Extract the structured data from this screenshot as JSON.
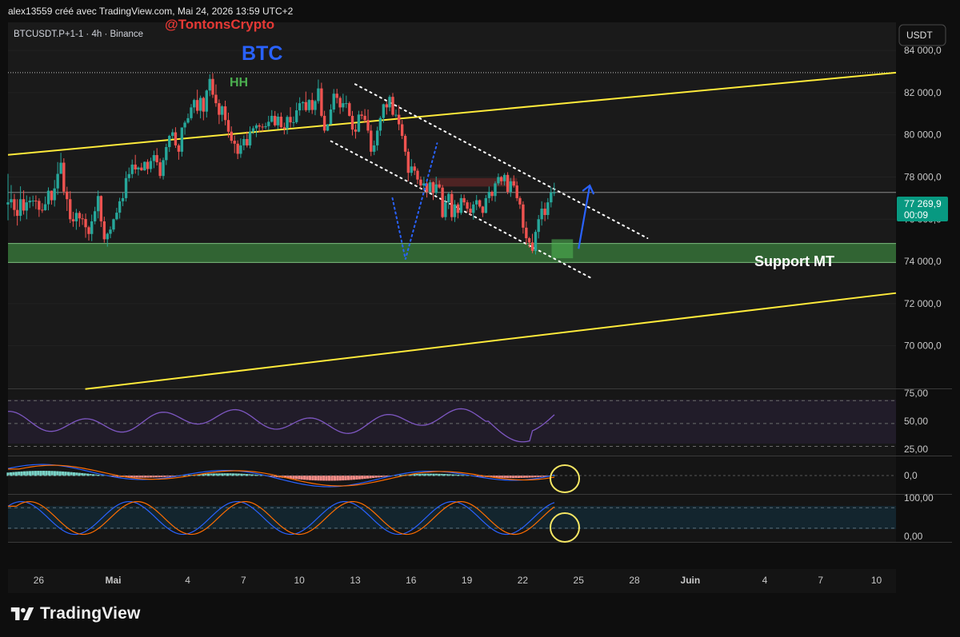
{
  "header": {
    "credit": "alex13559 créé avec TradingView.com, Mai 24, 2026 13:59 UTC+2"
  },
  "chart_data": {
    "type": "candlestick",
    "symbol_line": "BTCUSDT.P+1-1 · 4h · Binance",
    "currency_button": "USDT",
    "watermark": "@TontonsCrypto",
    "title": "BTC",
    "annotations": {
      "hh": "HH",
      "support": "Support MT"
    },
    "last_price": {
      "value": 77269.9,
      "label": "77 269,9",
      "countdown": "00:09"
    },
    "price_axis": {
      "ticks": [
        84000,
        82000,
        80000,
        78000,
        76000,
        74000,
        72000,
        70000
      ],
      "labels": [
        "84 000,0",
        "82 000,0",
        "80 000,0",
        "78 000,0",
        "76 000,0",
        "74 000,0",
        "72 000,0",
        "70 000,0"
      ],
      "range": [
        67980,
        85330
      ]
    },
    "time_axis": {
      "labels": [
        "26",
        "Mai",
        "4",
        "7",
        "10",
        "13",
        "16",
        "19",
        "22",
        "25",
        "28",
        "Juin",
        "4",
        "7",
        "10"
      ],
      "day_index": [
        26,
        30,
        34,
        37,
        40,
        43,
        46,
        49,
        52,
        55,
        58,
        61,
        65,
        68,
        71
      ],
      "range": [
        24.35,
        72.05
      ]
    },
    "high_line": 82950,
    "support_zone": [
      73950,
      74850
    ],
    "channel": {
      "upper": [
        [
          24.35,
          79050
        ],
        [
          72.05,
          82950
        ]
      ],
      "lower": [
        [
          28.5,
          67950
        ],
        [
          72.05,
          72500
        ]
      ]
    },
    "descending_channel": {
      "upper": [
        [
          43.0,
          82400
        ],
        [
          58.7,
          75100
        ]
      ],
      "lower": [
        [
          41.7,
          79700
        ],
        [
          55.7,
          73200
        ]
      ]
    },
    "projection": {
      "past": [
        [
          45.0,
          77000
        ],
        [
          45.7,
          74100
        ],
        [
          47.4,
          79600
        ]
      ],
      "future": [
        [
          55.0,
          74600
        ],
        [
          55.6,
          77600
        ]
      ]
    },
    "candles": [
      [
        24.35,
        76700,
        76800,
        78150,
        75950
      ],
      [
        24.52,
        76800,
        76950,
        77620,
        76530
      ],
      [
        24.69,
        76950,
        76440,
        77200,
        76140
      ],
      [
        24.85,
        76440,
        76160,
        76950,
        75700
      ],
      [
        25.02,
        76160,
        76950,
        77560,
        75910
      ],
      [
        25.19,
        76950,
        76410,
        77370,
        76220
      ],
      [
        25.35,
        76410,
        76800,
        77130,
        76000
      ],
      [
        25.52,
        76800,
        76880,
        77060,
        76530
      ],
      [
        25.69,
        76880,
        76880,
        77120,
        76610
      ],
      [
        25.85,
        76880,
        76870,
        77130,
        76480
      ],
      [
        26.02,
        76870,
        76450,
        76990,
        76110
      ],
      [
        26.19,
        76450,
        76430,
        76760,
        76300
      ],
      [
        26.35,
        76430,
        76710,
        77080,
        76400
      ],
      [
        26.52,
        76710,
        77350,
        77510,
        76420
      ],
      [
        26.69,
        77350,
        76900,
        77360,
        76690
      ],
      [
        26.85,
        76900,
        77460,
        77860,
        76600
      ],
      [
        27.02,
        77460,
        78150,
        78710,
        77160
      ],
      [
        27.19,
        78150,
        78680,
        79150,
        78210
      ],
      [
        27.35,
        78680,
        77310,
        78890,
        77140
      ],
      [
        27.52,
        77310,
        76950,
        77540,
        76390
      ],
      [
        27.69,
        76950,
        76000,
        77330,
        75820
      ],
      [
        27.85,
        76000,
        75900,
        76350,
        75640
      ],
      [
        28.02,
        75900,
        76300,
        76490,
        75500
      ],
      [
        28.19,
        76300,
        76040,
        76390,
        75640
      ],
      [
        28.35,
        76040,
        76010,
        76250,
        75730
      ],
      [
        28.52,
        76010,
        75620,
        76270,
        75120
      ],
      [
        28.69,
        75620,
        75300,
        75690,
        74990
      ],
      [
        28.85,
        75300,
        75900,
        76220,
        74960
      ],
      [
        29.02,
        75900,
        76380,
        76590,
        75760
      ],
      [
        29.19,
        76380,
        77100,
        77360,
        76040
      ],
      [
        29.35,
        77100,
        75900,
        77130,
        75630
      ],
      [
        29.52,
        75900,
        75050,
        76120,
        74890
      ],
      [
        29.69,
        75050,
        75310,
        75370,
        74700
      ],
      [
        29.85,
        75310,
        75510,
        75660,
        75100
      ],
      [
        30.02,
        75510,
        76000,
        76030,
        75400
      ],
      [
        30.19,
        76000,
        76310,
        76540,
        75950
      ],
      [
        30.35,
        76310,
        76850,
        77020,
        76030
      ],
      [
        30.52,
        76850,
        77000,
        77260,
        76620
      ],
      [
        30.69,
        77000,
        77950,
        78270,
        76840
      ],
      [
        30.85,
        77950,
        78140,
        78450,
        77780
      ],
      [
        31.02,
        78140,
        78590,
        78830,
        77950
      ],
      [
        31.19,
        78590,
        78360,
        79050,
        78160
      ],
      [
        31.35,
        78360,
        78450,
        78500,
        78070
      ],
      [
        31.52,
        78450,
        78320,
        78670,
        78290
      ],
      [
        31.69,
        78320,
        78720,
        78740,
        78290
      ],
      [
        31.85,
        78720,
        78380,
        78840,
        78130
      ],
      [
        32.02,
        78380,
        78760,
        78920,
        78220
      ],
      [
        32.19,
        78760,
        79040,
        79250,
        78420
      ],
      [
        32.35,
        79040,
        78700,
        79370,
        78550
      ],
      [
        32.52,
        78700,
        78050,
        78880,
        77930
      ],
      [
        32.69,
        78050,
        78800,
        78920,
        77880
      ],
      [
        32.85,
        78800,
        79420,
        79580,
        78570
      ],
      [
        33.02,
        79420,
        79950,
        80000,
        79190
      ],
      [
        33.19,
        79950,
        80120,
        80280,
        79810
      ],
      [
        33.35,
        80120,
        79500,
        80360,
        79380
      ],
      [
        33.52,
        79500,
        79200,
        79580,
        78820
      ],
      [
        33.69,
        79200,
        80350,
        80350,
        78970
      ],
      [
        33.85,
        80350,
        80580,
        80670,
        80010
      ],
      [
        34.02,
        80580,
        80790,
        81010,
        80530
      ],
      [
        34.19,
        80790,
        81300,
        81460,
        80690
      ],
      [
        34.35,
        81300,
        81650,
        81710,
        81030
      ],
      [
        34.52,
        81650,
        81140,
        82140,
        80990
      ],
      [
        34.69,
        81140,
        81750,
        81860,
        80780
      ],
      [
        34.85,
        81750,
        81100,
        81810,
        80690
      ],
      [
        35.02,
        81100,
        82100,
        82150,
        80820
      ],
      [
        35.19,
        82100,
        82650,
        82870,
        81830
      ],
      [
        35.35,
        82650,
        81900,
        82920,
        81750
      ],
      [
        35.52,
        81900,
        81500,
        82390,
        81330
      ],
      [
        35.69,
        81500,
        80950,
        81680,
        80510
      ],
      [
        35.85,
        80950,
        81350,
        81410,
        80640
      ],
      [
        36.02,
        81350,
        80700,
        81620,
        80450
      ],
      [
        36.19,
        80700,
        80150,
        81050,
        79860
      ],
      [
        36.35,
        80150,
        79720,
        80400,
        79590
      ],
      [
        36.52,
        79720,
        79580,
        79960,
        79130
      ],
      [
        36.69,
        79580,
        79100,
        79740,
        78850
      ],
      [
        36.85,
        79100,
        79500,
        79830,
        78910
      ],
      [
        37.02,
        79500,
        79800,
        79970,
        79270
      ],
      [
        37.19,
        79800,
        79500,
        80160,
        79400
      ],
      [
        37.35,
        79500,
        80150,
        80400,
        79360
      ],
      [
        37.52,
        80150,
        80310,
        80420,
        80040
      ],
      [
        37.69,
        80310,
        80450,
        80540,
        79890
      ],
      [
        37.85,
        80450,
        80390,
        80550,
        80120
      ],
      [
        38.02,
        80390,
        80360,
        80530,
        80160
      ],
      [
        38.19,
        80360,
        80410,
        80580,
        80260
      ],
      [
        38.35,
        80410,
        80620,
        80900,
        80220
      ],
      [
        38.52,
        80620,
        80900,
        81170,
        80580
      ],
      [
        38.69,
        80900,
        80450,
        81130,
        80380
      ],
      [
        38.85,
        80450,
        80860,
        81020,
        80270
      ],
      [
        39.02,
        80860,
        80360,
        81060,
        80300
      ],
      [
        39.19,
        80360,
        80300,
        80580,
        80020
      ],
      [
        39.35,
        80300,
        80850,
        80930,
        80030
      ],
      [
        39.52,
        80850,
        80590,
        81310,
        80330
      ],
      [
        39.69,
        80590,
        80600,
        80870,
        80380
      ],
      [
        39.85,
        80600,
        81160,
        81530,
        80520
      ],
      [
        40.02,
        81160,
        81500,
        81780,
        80910
      ],
      [
        40.19,
        81500,
        81550,
        81600,
        81160
      ],
      [
        40.35,
        81550,
        81170,
        82050,
        81090
      ],
      [
        40.52,
        81170,
        81650,
        81690,
        81050
      ],
      [
        40.69,
        81650,
        81180,
        81990,
        80990
      ],
      [
        40.85,
        81180,
        81600,
        81660,
        80930
      ],
      [
        41.02,
        81600,
        82200,
        82620,
        81480
      ],
      [
        41.19,
        82200,
        80900,
        82470,
        80830
      ],
      [
        41.35,
        80900,
        80200,
        81140,
        80090
      ],
      [
        41.52,
        80200,
        80500,
        80510,
        80170
      ],
      [
        41.69,
        80500,
        81200,
        81450,
        80470
      ],
      [
        41.85,
        81200,
        81950,
        82170,
        81060
      ],
      [
        42.02,
        81950,
        81750,
        82180,
        81490
      ],
      [
        42.19,
        81750,
        81300,
        81830,
        80990
      ],
      [
        42.35,
        81300,
        81500,
        81950,
        81100
      ],
      [
        42.52,
        81500,
        81500,
        81860,
        81270
      ],
      [
        42.69,
        81500,
        80900,
        81580,
        80870
      ],
      [
        42.85,
        80900,
        80250,
        81130,
        79970
      ],
      [
        43.02,
        80250,
        80150,
        80500,
        79820
      ],
      [
        43.19,
        80150,
        80960,
        81140,
        80120
      ],
      [
        43.35,
        80960,
        80900,
        81130,
        80740
      ],
      [
        43.52,
        80900,
        80700,
        81220,
        80560
      ],
      [
        43.69,
        80700,
        80200,
        81200,
        80080
      ],
      [
        43.85,
        80200,
        79200,
        80470,
        78990
      ],
      [
        44.02,
        79200,
        79500,
        79730,
        79040
      ],
      [
        44.19,
        79500,
        80200,
        80390,
        79250
      ],
      [
        44.35,
        80200,
        80800,
        80890,
        79950
      ],
      [
        44.52,
        80800,
        81450,
        81480,
        80570
      ],
      [
        44.69,
        81450,
        81300,
        81570,
        80960
      ],
      [
        44.85,
        81300,
        81800,
        81890,
        81120
      ],
      [
        45.02,
        81800,
        80950,
        81980,
        80880
      ],
      [
        45.19,
        80950,
        80950,
        81200,
        80820
      ],
      [
        45.35,
        80950,
        80500,
        81410,
        80220
      ],
      [
        45.52,
        80500,
        79950,
        80710,
        79800
      ],
      [
        45.69,
        79950,
        79200,
        80040,
        79010
      ],
      [
        45.85,
        79200,
        78200,
        79350,
        77810
      ],
      [
        46.02,
        78200,
        78500,
        78850,
        78050
      ],
      [
        46.19,
        78500,
        78300,
        78660,
        78090
      ],
      [
        46.35,
        78300,
        77880,
        78410,
        77670
      ],
      [
        46.52,
        77880,
        77600,
        78030,
        77430
      ],
      [
        46.69,
        77600,
        77700,
        78010,
        77390
      ],
      [
        46.85,
        77700,
        77300,
        77880,
        77030
      ],
      [
        47.02,
        77300,
        77750,
        77860,
        77270
      ],
      [
        47.19,
        77750,
        77250,
        77790,
        76910
      ],
      [
        47.35,
        77250,
        77650,
        78020,
        77150
      ],
      [
        47.52,
        77650,
        77500,
        77840,
        77440
      ],
      [
        47.69,
        77500,
        76100,
        77620,
        76050
      ],
      [
        47.85,
        76100,
        76800,
        77110,
        75950
      ],
      [
        48.02,
        76800,
        77200,
        77290,
        76480
      ],
      [
        48.19,
        77200,
        76100,
        77370,
        75920
      ],
      [
        48.35,
        76100,
        76700,
        76910,
        75870
      ],
      [
        48.52,
        76700,
        76300,
        76790,
        76040
      ],
      [
        48.69,
        76300,
        77000,
        77180,
        76210
      ],
      [
        48.85,
        77000,
        76800,
        77170,
        76650
      ],
      [
        49.02,
        76800,
        76500,
        76910,
        76330
      ],
      [
        49.19,
        76500,
        76300,
        76800,
        76160
      ],
      [
        49.35,
        76300,
        76700,
        76850,
        75980
      ],
      [
        49.52,
        76700,
        76900,
        77150,
        76430
      ],
      [
        49.69,
        76900,
        76600,
        76940,
        76520
      ],
      [
        49.85,
        76600,
        76300,
        76630,
        76100
      ],
      [
        50.02,
        76300,
        77000,
        77150,
        76280
      ],
      [
        50.19,
        77000,
        77300,
        77550,
        76770
      ],
      [
        50.35,
        77300,
        77100,
        77360,
        76870
      ],
      [
        50.52,
        77100,
        77700,
        77800,
        76830
      ],
      [
        50.69,
        77700,
        78000,
        78170,
        77600
      ],
      [
        50.85,
        78000,
        77800,
        78050,
        77620
      ],
      [
        51.02,
        77800,
        78100,
        78190,
        77600
      ],
      [
        51.19,
        78100,
        77300,
        78230,
        77190
      ],
      [
        51.35,
        77300,
        77800,
        77960,
        77060
      ],
      [
        51.52,
        77800,
        77600,
        78080,
        77500
      ],
      [
        51.69,
        77600,
        77000,
        77790,
        76860
      ],
      [
        51.85,
        77000,
        76700,
        77090,
        76490
      ],
      [
        52.02,
        76700,
        75600,
        76850,
        75320
      ],
      [
        52.19,
        75600,
        75100,
        75890,
        74790
      ],
      [
        52.35,
        75100,
        74900,
        75160,
        74650
      ],
      [
        52.52,
        74900,
        74500,
        75310,
        74390
      ],
      [
        52.69,
        74500,
        75400,
        75500,
        74330
      ],
      [
        52.85,
        75400,
        76000,
        76200,
        75090
      ],
      [
        53.02,
        76000,
        76500,
        76850,
        75700
      ],
      [
        53.19,
        76500,
        76200,
        76790,
        75910
      ],
      [
        53.35,
        76200,
        76800,
        77000,
        76000
      ],
      [
        53.52,
        76800,
        77270,
        77520,
        76560
      ],
      [
        53.69,
        77270,
        77270,
        77730,
        77100
      ]
    ],
    "panels": {
      "rsi": {
        "labels": [
          "75,00",
          "50,00",
          "25,00"
        ],
        "levels": [
          70,
          50,
          30
        ],
        "range": [
          22,
          80
        ]
      },
      "macd": {
        "label": "0,0"
      },
      "stoch": {
        "labels": [
          "100,00",
          "0,00"
        ],
        "levels": [
          80,
          20
        ],
        "range": [
          -20,
          118
        ]
      }
    },
    "colors": {
      "up": "#26a69a",
      "down": "#ef5350",
      "channel": "#ffeb3b",
      "support": "#2e7d32",
      "rsi": "#7e57c2",
      "macd": "#2962ff",
      "signal": "#ff6d00",
      "projection": "#2962ff",
      "last_price": "#089981"
    }
  },
  "brand": {
    "name": "TradingView"
  }
}
